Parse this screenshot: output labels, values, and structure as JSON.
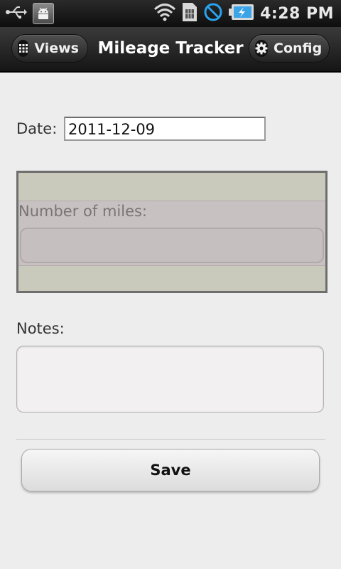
{
  "status_bar": {
    "time": "4:28 PM",
    "icons": [
      "usb-icon",
      "android-debug-icon",
      "wifi-icon",
      "sim-card-icon",
      "blocked-icon",
      "battery-charging-icon"
    ]
  },
  "title_bar": {
    "title": "Mileage Tracker",
    "views_label": "Views",
    "config_label": "Config"
  },
  "form": {
    "date_label": "Date:",
    "date_value": "2011-12-09",
    "miles_label": "Number of miles:",
    "miles_value": "",
    "notes_label": "Notes:",
    "notes_value": "",
    "save_label": "Save"
  },
  "colors": {
    "background": "#ededed",
    "titlebar": "#1e1e1e",
    "highlight": "#c9cabc",
    "battery": "#3ba3e8",
    "blocked": "#29a3f0"
  }
}
